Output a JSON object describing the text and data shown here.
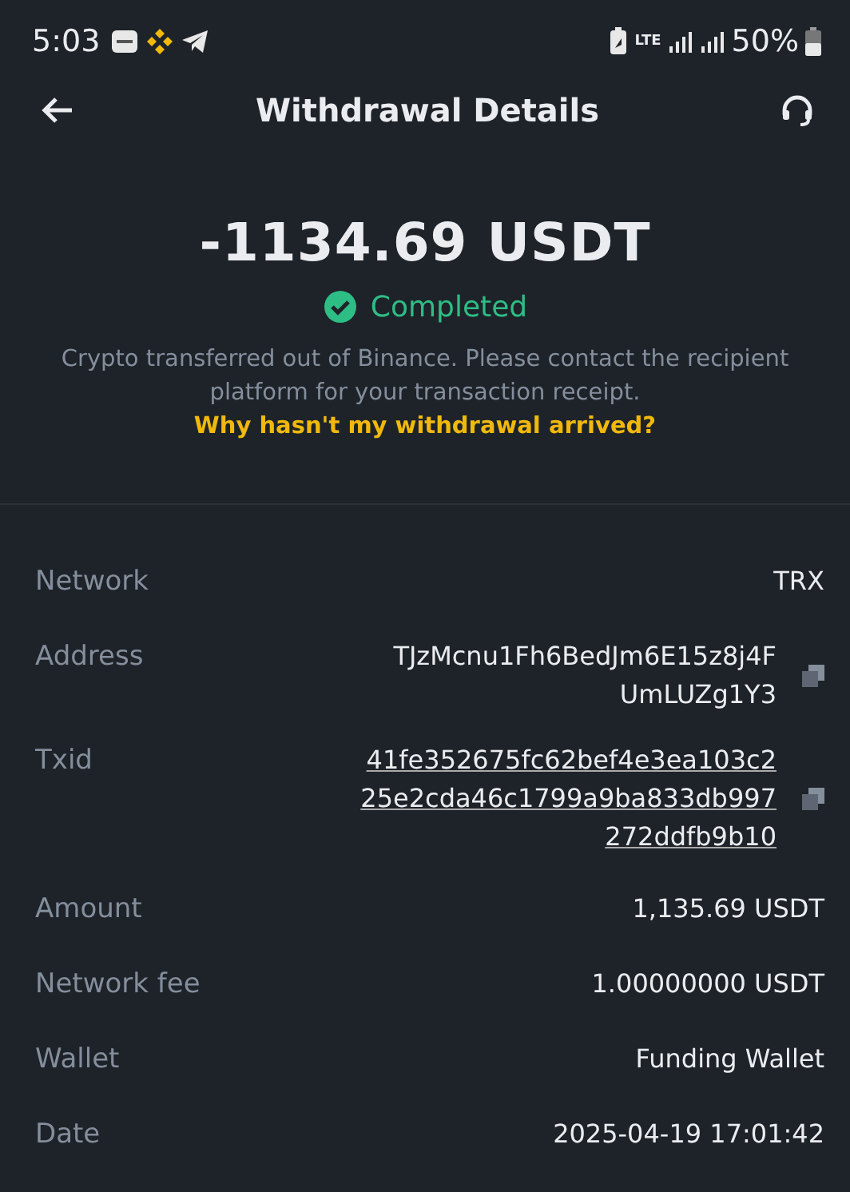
{
  "status_bar": {
    "time": "5:03",
    "network": "LTE",
    "battery": "50%"
  },
  "header": {
    "title": "Withdrawal Details"
  },
  "summary": {
    "amount": "-1134.69 USDT",
    "status": {
      "label": "Completed",
      "kind": "success"
    },
    "note": "Crypto transferred out of Binance. Please contact the recipient platform for your transaction receipt.",
    "help_link": "Why hasn't my withdrawal arrived?"
  },
  "details": [
    {
      "label": "Network",
      "lines": [
        "TRX"
      ],
      "kind": "plain"
    },
    {
      "label": "Address",
      "lines": [
        "TJzMcnu1Fh6BedJm6E15z8j4F",
        "UmLUZg1Y3"
      ],
      "kind": "copy"
    },
    {
      "label": "Txid",
      "lines": [
        "41fe352675fc62bef4e3ea103c2",
        "25e2cda46c1799a9ba833db997",
        "272ddfb9b10"
      ],
      "kind": "link-copy"
    },
    {
      "label": "Amount",
      "lines": [
        "1,135.69 USDT"
      ],
      "kind": "plain"
    },
    {
      "label": "Network fee",
      "lines": [
        "1.00000000 USDT"
      ],
      "kind": "plain"
    },
    {
      "label": "Wallet",
      "lines": [
        "Funding Wallet"
      ],
      "kind": "plain"
    },
    {
      "label": "Date",
      "lines": [
        "2025-04-19 17:01:42"
      ],
      "kind": "plain"
    }
  ]
}
